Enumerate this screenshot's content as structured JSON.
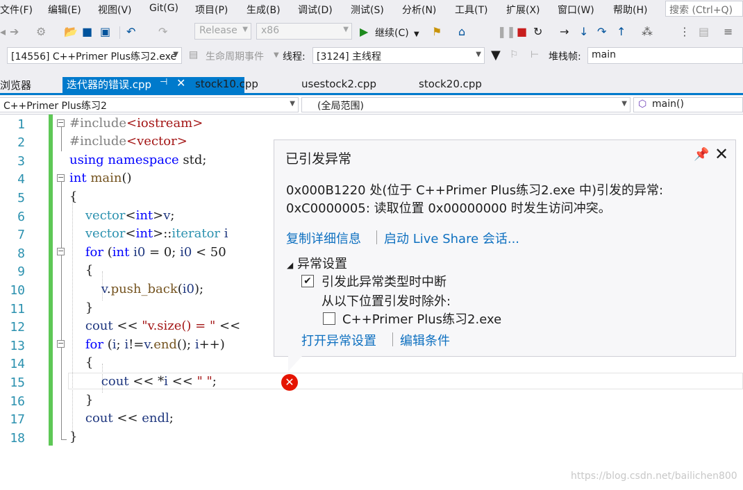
{
  "menu": {
    "items": [
      "文件(F)",
      "编辑(E)",
      "视图(V)",
      "Git(G)",
      "项目(P)",
      "生成(B)",
      "调试(D)",
      "测试(S)",
      "分析(N)",
      "工具(T)",
      "扩展(X)",
      "窗口(W)",
      "帮助(H)"
    ],
    "search_placeholder": "搜索 (Ctrl+Q)"
  },
  "toolbar": {
    "config": "Release",
    "platform": "x86",
    "continue_label": "继续(C)"
  },
  "debug_bar": {
    "process": "[14556] C++Primer Plus练习2.exe",
    "lifecycle_label": "生命周期事件",
    "thread_label": "线程:",
    "thread_value": "[3124] 主线程",
    "stackframe_label": "堆栈帧:",
    "stackframe_value": "main"
  },
  "tabs": {
    "left_panel": "浏览器",
    "active": "迭代器的错误.cpp",
    "others": [
      "stock10.cpp",
      "usestock2.cpp",
      "stock20.cpp"
    ]
  },
  "navbar": {
    "project": "C++Primer Plus练习2",
    "scope": "(全局范围)",
    "member": "main()"
  },
  "editor": {
    "line_numbers": [
      "1",
      "2",
      "3",
      "4",
      "5",
      "6",
      "7",
      "8",
      "9",
      "10",
      "11",
      "12",
      "13",
      "14",
      "15",
      "16",
      "17",
      "18"
    ]
  },
  "exception": {
    "title": "已引发异常",
    "message_line1": "0x000B1220 处(位于 C++Primer Plus练习2.exe 中)引发的异常:",
    "message_line2": "0xC0000005: 读取位置 0x00000000 时发生访问冲突。",
    "copy_details": "复制详细信息",
    "live_share": "启动 Live Share 会话...",
    "settings_header": "异常设置",
    "break_when_thrown": "引发此异常类型时中断",
    "except_when_from": "从以下位置引发时除外:",
    "module": "C++Primer Plus练习2.exe",
    "open_settings": "打开异常设置",
    "edit_conditions": "编辑条件"
  },
  "watermark": "https://blog.csdn.net/bailichen800"
}
